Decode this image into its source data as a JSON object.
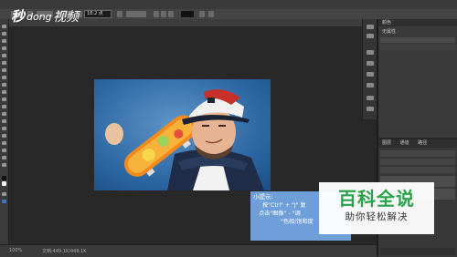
{
  "app": {
    "options_bar": {
      "size_field": "18.2 点"
    },
    "document": {
      "tab_title": ""
    },
    "statusbar": {
      "zoom": "100%",
      "doc_info": "文档:449.1K/449.1K"
    }
  },
  "panels": {
    "top_panel": {
      "tab_label": "颜色",
      "item_label": "无属性"
    },
    "layers_panel": {
      "tabs": [
        "图层",
        "通道",
        "路径"
      ]
    }
  },
  "tip_box": {
    "title": "小提示:",
    "lines": [
      "按\"Ctrl\" + \"J\" 复",
      "点击\"图像\" - \"调",
      "\"色相/饱和度"
    ]
  },
  "watermark": {
    "title": "百科全说",
    "subtitle": "助你轻松解决"
  },
  "logo_text": "秒懂视频",
  "colors": {
    "tip_bg": "#6f9fd8",
    "watermark_green": "#2aa34a",
    "app_bg": "#2b2b2b"
  }
}
